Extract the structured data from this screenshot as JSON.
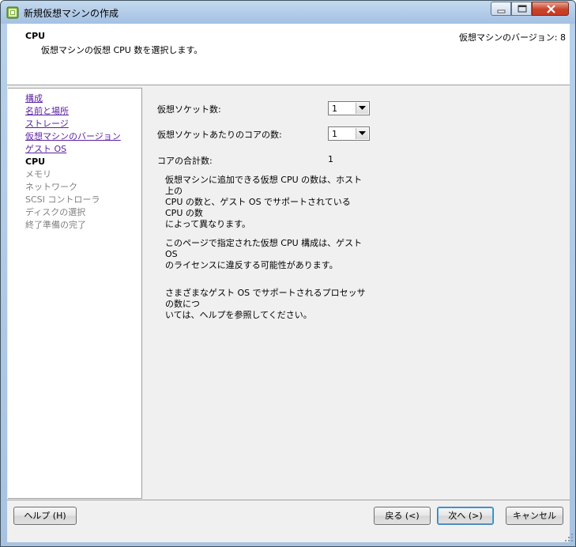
{
  "window": {
    "title": "新規仮想マシンの作成",
    "icon": "vsphere-app-icon"
  },
  "header": {
    "title": "CPU",
    "description": "仮想マシンの仮想 CPU 数を選択します。",
    "version": "仮想マシンのバージョン: 8"
  },
  "nav": {
    "items": [
      {
        "label": "構成",
        "state": "visited"
      },
      {
        "label": "名前と場所",
        "state": "visited"
      },
      {
        "label": "ストレージ",
        "state": "visited"
      },
      {
        "label": "仮想マシンのバージョン",
        "state": "visited"
      },
      {
        "label": "ゲスト OS",
        "state": "visited"
      },
      {
        "label": "CPU",
        "state": "current"
      },
      {
        "label": "メモリ",
        "state": "pending"
      },
      {
        "label": "ネットワーク",
        "state": "pending"
      },
      {
        "label": "SCSI コントローラ",
        "state": "pending"
      },
      {
        "label": "ディスクの選択",
        "state": "pending"
      },
      {
        "label": "終了準備の完了",
        "state": "pending"
      }
    ]
  },
  "form": {
    "sockets_label": "仮想ソケット数:",
    "sockets_value": "1",
    "cores_label": "仮想ソケットあたりのコアの数:",
    "cores_value": "1",
    "total_label": "コアの合計数:",
    "total_value": "1"
  },
  "notes": {
    "p1_lines": [
      "仮想マシンに追加できる仮想 CPU の数は、ホスト上の",
      "CPU の数と、ゲスト OS でサポートされている CPU の数",
      "によって異なります。"
    ],
    "p2_lines": [
      "このページで指定された仮想 CPU 構成は、ゲスト OS",
      "のライセンスに違反する可能性があります。"
    ],
    "p3_lines": [
      "さまざまなゲスト OS でサポートされるプロセッサの数につ",
      "いては、ヘルプを参照してください。"
    ]
  },
  "footer": {
    "help": "ヘルプ (H)",
    "back": "戻る (<)",
    "next": "次へ (>)",
    "cancel": "キャンセル"
  },
  "colors": {
    "link": "#5a1fa0",
    "disabled": "#808080",
    "panel": "#f0f0f0",
    "frame": "#b3cce8"
  }
}
